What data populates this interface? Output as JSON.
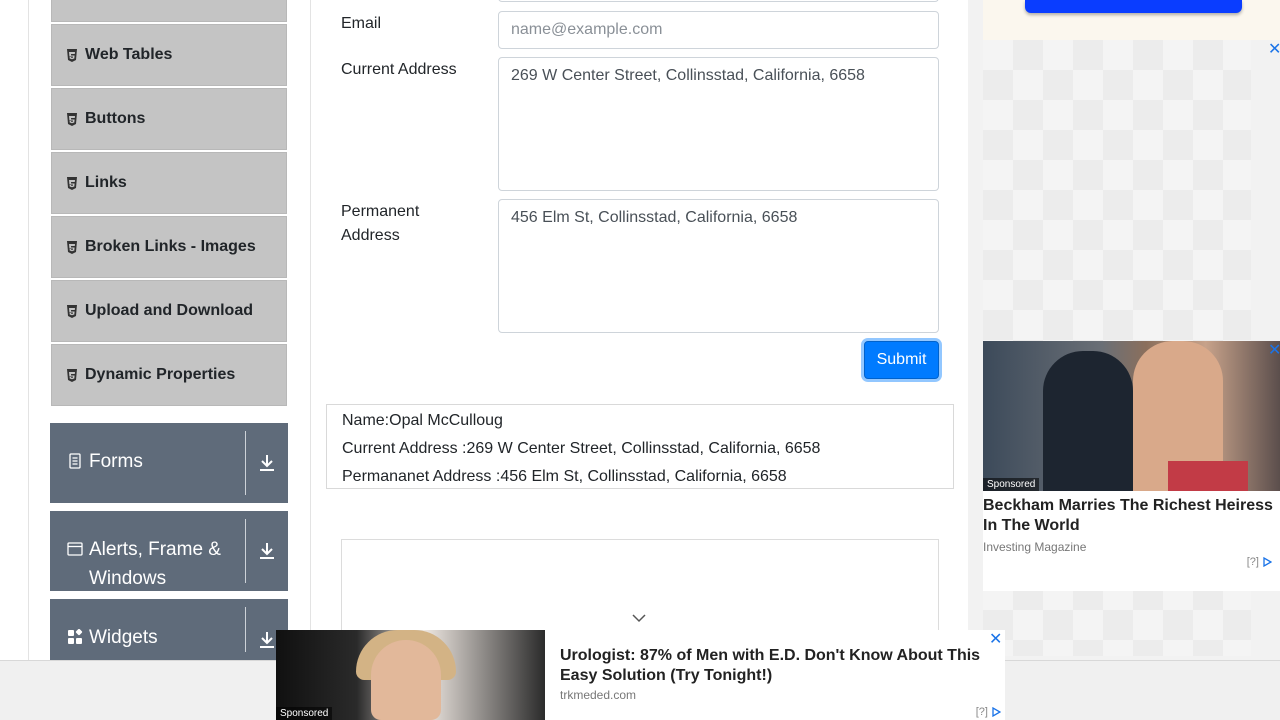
{
  "sidebar": {
    "elements_items": [
      {
        "label": "Web Tables"
      },
      {
        "label": "Buttons"
      },
      {
        "label": "Links"
      },
      {
        "label": "Broken Links - Images"
      },
      {
        "label": "Upload and Download"
      },
      {
        "label": "Dynamic Properties"
      }
    ],
    "groups": [
      {
        "label": "Forms",
        "icon": "document-icon"
      },
      {
        "label": "Alerts, Frame & Windows",
        "icon": "window-icon"
      },
      {
        "label": "Widgets",
        "icon": "widgets-icon"
      }
    ]
  },
  "form": {
    "email_label": "Email",
    "email_placeholder": "name@example.com",
    "email_value": "",
    "current_address_label": "Current Address",
    "current_address_value": "269 W Center Street, Collinsstad, California, 6658",
    "permanent_address_label": "Permanent Address",
    "permanent_address_value": "456 Elm St, Collinsstad, California, 6658",
    "submit_label": "Submit"
  },
  "output": {
    "name": "Name:Opal McCulloug",
    "current_address": "Current Address :269 W Center Street, Collinsstad, California, 6658",
    "permanent_address": "Permananet Address :456 Elm St, Collinsstad, California, 6658"
  },
  "right_ad": {
    "sponsored": "Sponsored",
    "title": "Beckham Marries The Richest Heiress In The World",
    "source": "Investing Magazine",
    "meta": "[?]"
  },
  "bottom_ad": {
    "sponsored": "Sponsored",
    "title": "Urologist: 87% of Men with E.D. Don't Know About This Easy Solution (Try Tonight!)",
    "source": "trkmeded.com",
    "meta": "[?]"
  },
  "colors": {
    "accent": "#007bff",
    "menu_item_bg": "#c4c4c4",
    "group_bg": "#5f6b7a"
  }
}
